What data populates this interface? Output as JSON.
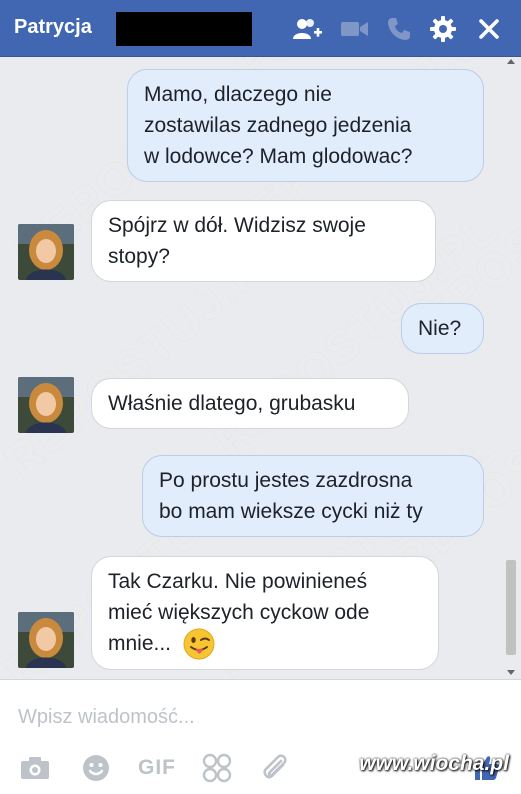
{
  "header": {
    "contact_name": "Patrycja",
    "icons": [
      "add-people-icon",
      "video-call-icon",
      "phone-call-icon",
      "gear-icon",
      "close-icon"
    ],
    "color": "#4267b2"
  },
  "watermark_text": "REPOSTUJ.PL",
  "messages": [
    {
      "direction": "out",
      "lines": [
        "Mamo, dlaczego nie",
        "zostawilas zadnego jedzenia",
        "w lodowce? Mam glodowac?"
      ]
    },
    {
      "direction": "in",
      "lines": [
        "Spójrz w dół. Widzisz swoje",
        "stopy?"
      ]
    },
    {
      "direction": "out",
      "lines": [
        "Nie?"
      ]
    },
    {
      "direction": "in",
      "lines": [
        "Właśnie dlatego, grubasku"
      ]
    },
    {
      "direction": "out",
      "lines": [
        "Po prostu jestes zazdrosna",
        "bo mam wieksze cycki niż ty"
      ]
    },
    {
      "direction": "in",
      "lines": [
        "Tak Czarku. Nie powinieneś",
        "mieć większych cyckow ode",
        "mnie..."
      ],
      "emoji": "winking-tongue-emoji"
    }
  ],
  "composer": {
    "placeholder": "Wpisz wiadomość...",
    "tools": [
      "camera-icon",
      "smiley-icon",
      "GIF",
      "sticker-icon",
      "attachment-icon"
    ],
    "gif_label": "GIF"
  },
  "site_watermark": "www.wiocha.pl",
  "colors": {
    "outgoing_bubble": "#e1edfb",
    "incoming_bubble": "#ffffff",
    "chat_background": "#e9ebee"
  }
}
